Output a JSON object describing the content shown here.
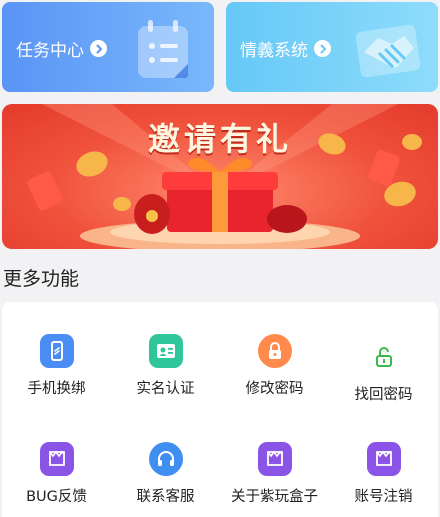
{
  "cards": {
    "task": {
      "label": "任务中心",
      "icon": "calendar-icon"
    },
    "friend": {
      "label": "情義系统",
      "icon": "handshake-icon"
    }
  },
  "banner": {
    "title": "邀请有礼"
  },
  "section": {
    "title": "更多功能"
  },
  "features": [
    {
      "label": "手机换绑",
      "icon": "phone-icon",
      "color": "#4a8df5"
    },
    {
      "label": "实名认证",
      "icon": "id-card-icon",
      "color": "#2fc79a"
    },
    {
      "label": "修改密码",
      "icon": "lock-icon",
      "color": "#ff8a4c"
    },
    {
      "label": "找回密码",
      "icon": "unlock-icon",
      "color": "#3dbb4a"
    },
    {
      "label": "BUG反馈",
      "icon": "feedback-icon",
      "color": "#8a55e6"
    },
    {
      "label": "联系客服",
      "icon": "headset-icon",
      "color": "#3f8ef0"
    },
    {
      "label": "关于紫玩盒子",
      "icon": "box-icon",
      "color": "#8a55e6"
    },
    {
      "label": "账号注销",
      "icon": "box-icon",
      "color": "#8a55e6"
    }
  ]
}
